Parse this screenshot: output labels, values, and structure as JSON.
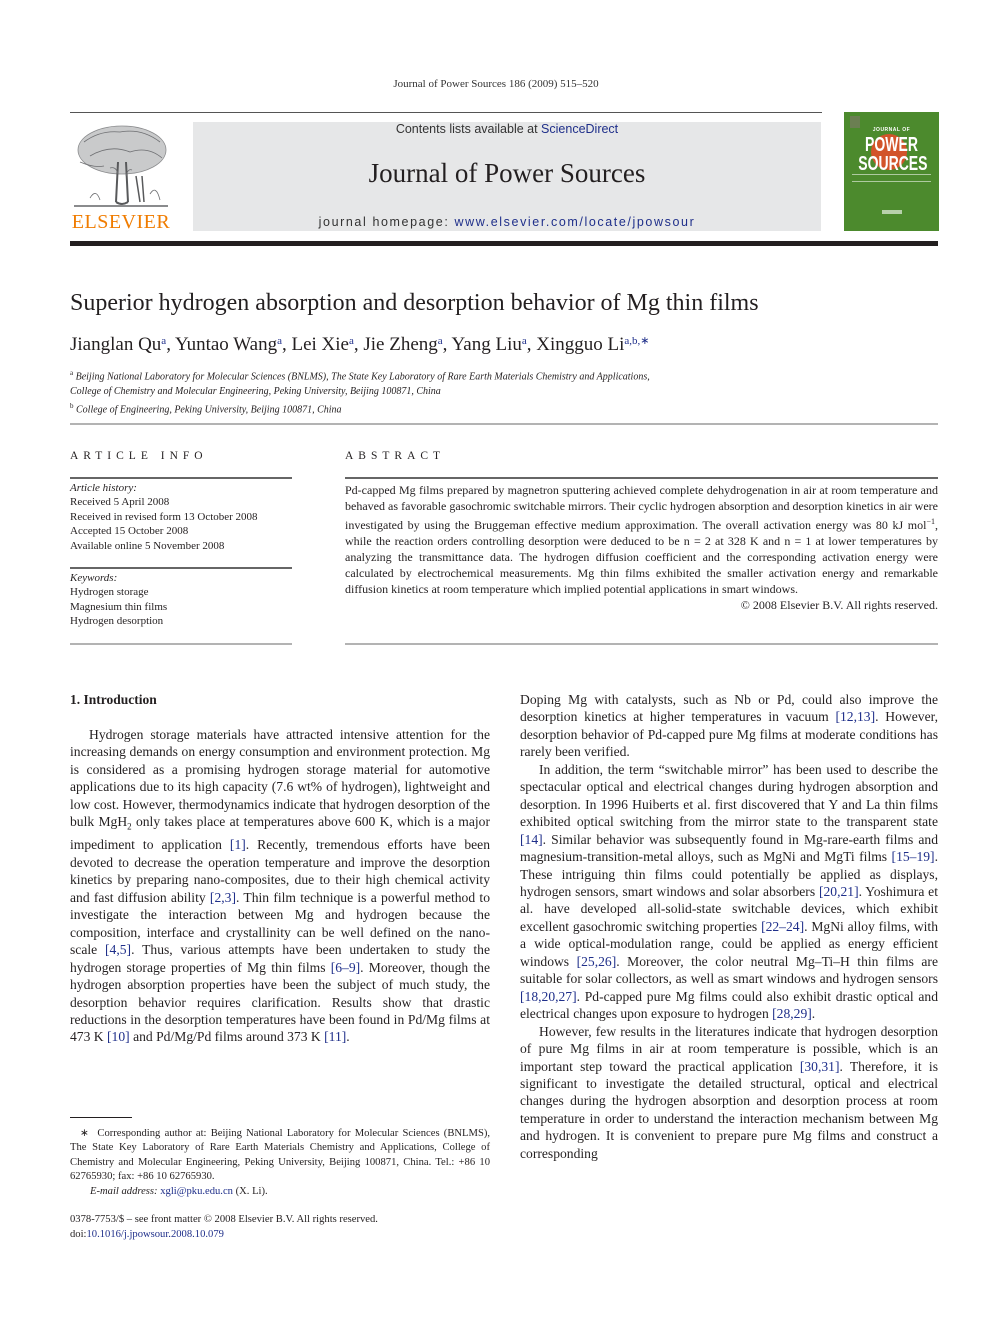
{
  "running_head": "Journal of Power Sources 186 (2009) 515–520",
  "masthead": {
    "publisher_logo_text": "ELSEVIER",
    "contents_prefix": "Contents lists available at ",
    "contents_link": "ScienceDirect",
    "journal_title": "Journal of Power Sources",
    "homepage_prefix": "journal homepage: ",
    "homepage_link": "www.elsevier.com/locate/jpowsour",
    "cover": {
      "line1": "JOURNAL OF",
      "line2": "POWER",
      "line3": "SOURCES"
    },
    "colors": {
      "elsevier_orange": "#f07c00",
      "cover_green": "#4c8a2d",
      "cover_sun": "#d2542a",
      "link_blue": "#1f2f8a",
      "masthead_gray": "#e6e7e8"
    }
  },
  "article": {
    "title": "Superior hydrogen absorption and desorption behavior of Mg thin films",
    "authors": [
      {
        "name": "Jianglan Qu",
        "sup": "a"
      },
      {
        "name": "Yuntao Wang",
        "sup": "a"
      },
      {
        "name": "Lei Xie",
        "sup": "a"
      },
      {
        "name": "Jie Zheng",
        "sup": "a"
      },
      {
        "name": "Yang Liu",
        "sup": "a"
      },
      {
        "name": "Xingguo Li",
        "sup": "a,b,∗"
      }
    ],
    "affiliations": [
      {
        "sup": "a",
        "line1": "Beijing National Laboratory for Molecular Sciences (BNLMS), The State Key Laboratory of Rare Earth Materials Chemistry and Applications,",
        "line2": "College of Chemistry and Molecular Engineering, Peking University, Beijing 100871, China"
      },
      {
        "sup": "b",
        "line1": "College of Engineering, Peking University, Beijing 100871, China"
      }
    ]
  },
  "article_info": {
    "heading": "ARTICLE INFO",
    "history_label": "Article history:",
    "history": [
      "Received 5 April 2008",
      "Received in revised form 13 October 2008",
      "Accepted 15 October 2008",
      "Available online 5 November 2008"
    ],
    "keywords_label": "Keywords:",
    "keywords": [
      "Hydrogen storage",
      "Magnesium thin films",
      "Hydrogen desorption"
    ]
  },
  "abstract": {
    "heading": "ABSTRACT",
    "p1": "Pd-capped Mg films prepared by magnetron sputtering achieved complete dehydrogenation in air at room temperature and behaved as favorable gasochromic switchable mirrors. Their cyclic hydrogen absorption and desorption kinetics in air were investigated by using the Bruggeman effective medium approximation. The overall activation energy was 80 kJ mol",
    "p1_sup": "−1",
    "p2": ", while the reaction orders controlling desorption were deduced to be n = 2 at 328 K and n = 1 at lower temperatures by analyzing the transmittance data. The hydrogen diffusion coefficient and the corresponding activation energy were calculated by electrochemical measurements. Mg thin films exhibited the smaller activation energy and remarkable diffusion kinetics at room temperature which implied potential applications in smart windows.",
    "copyright": "© 2008 Elsevier B.V. All rights reserved."
  },
  "intro": {
    "section_title": "1.  Introduction",
    "left_p1_a": "Hydrogen storage materials have attracted intensive attention for the increasing demands on energy consumption and environment protection. Mg is considered as a promising hydrogen storage material for automotive applications due to its high capacity (7.6 wt% of hydrogen), lightweight and low cost. However, thermodynamics indicate that hydrogen desorption of the bulk MgH",
    "left_p1_sub": "2",
    "left_p1_b": " only takes place at temperatures above 600 K, which is a major impediment to application ",
    "ref1": "[1]",
    "left_p1_c": ". Recently, tremendous efforts have been devoted to decrease the operation temperature and improve the desorption kinetics by preparing nano-composites, due to their high chemical activity and fast diffusion ability ",
    "ref2": "[2,3]",
    "left_p1_d": ". Thin film technique is a powerful method to investigate the interaction between Mg and hydrogen because the composition, interface and crystallinity can be well defined on the nano-scale ",
    "ref3": "[4,5]",
    "left_p1_e": ". Thus, various attempts have been undertaken to study the hydrogen storage properties of Mg thin films ",
    "ref4": "[6–9]",
    "left_p1_f": ". Moreover, though the hydrogen absorption properties have been the subject of much study, the desorption behavior requires clarification. Results show that drastic reductions in the desorption temperatures have been found in Pd/Mg films at 473 K ",
    "ref5": "[10]",
    "left_p1_g": " and Pd/Mg/Pd films around 373 K ",
    "ref6": "[11]",
    "left_p1_h": ".",
    "right_p1_a": "Doping Mg with catalysts, such as Nb or Pd, could also improve the desorption kinetics at higher temperatures in vacuum ",
    "ref7": "[12,13]",
    "right_p1_b": ". However, desorption behavior of Pd-capped pure Mg films at moderate conditions has rarely been verified.",
    "right_p2_a": "In addition, the term “switchable mirror” has been used to describe the spectacular optical and electrical changes during hydrogen absorption and desorption. In 1996 Huiberts et al. first discovered that Y and La thin films exhibited optical switching from the mirror state to the transparent state ",
    "ref8": "[14]",
    "right_p2_b": ". Similar behavior was subsequently found in Mg-rare-earth films and magnesium-transition-metal alloys, such as MgNi and MgTi films ",
    "ref9": "[15–19]",
    "right_p2_c": ". These intriguing thin films could potentially be applied as displays, hydrogen sensors, smart windows and solar absorbers ",
    "ref10": "[20,21]",
    "right_p2_d": ". Yoshimura et al. have developed all-solid-state switchable devices, which exhibit excellent gasochromic switching properties ",
    "ref11": "[22–24]",
    "right_p2_e": ". MgNi alloy films, with a wide optical-modulation range, could be applied as energy efficient windows ",
    "ref12": "[25,26]",
    "right_p2_f": ". Moreover, the color neutral Mg–Ti–H thin films are suitable for solar collectors, as well as smart windows and hydrogen sensors ",
    "ref13": "[18,20,27]",
    "right_p2_g": ". Pd-capped pure Mg films could also exhibit drastic optical and electrical changes upon exposure to hydrogen ",
    "ref14": "[28,29]",
    "right_p2_h": ".",
    "right_p3_a": "However, few results in the literatures indicate that hydrogen desorption of pure Mg films in air at room temperature is possible, which is an important step toward the practical application ",
    "ref15": "[30,31]",
    "right_p3_b": ". Therefore, it is significant to investigate the detailed structural, optical and electrical changes during the hydrogen absorption and desorption process at room temperature in order to understand the interaction mechanism between Mg and hydrogen. It is convenient to prepare pure Mg films and construct a corresponding"
  },
  "footnote": {
    "marker": "∗",
    "text": "Corresponding author at: Beijing National Laboratory for Molecular Sciences (BNLMS), The State Key Laboratory of Rare Earth Materials Chemistry and Applications, College of Chemistry and Molecular Engineering, Peking University, Beijing 100871, China. Tel.: +86 10 62765930; fax: +86 10 62765930.",
    "email_label": "E-mail address:",
    "email": "xgli@pku.edu.cn",
    "email_suffix": " (X. Li)."
  },
  "bottom_meta": {
    "issn_line": "0378-7753/$ – see front matter © 2008 Elsevier B.V. All rights reserved.",
    "doi_prefix": "doi:",
    "doi": "10.1016/j.jpowsour.2008.10.079"
  }
}
